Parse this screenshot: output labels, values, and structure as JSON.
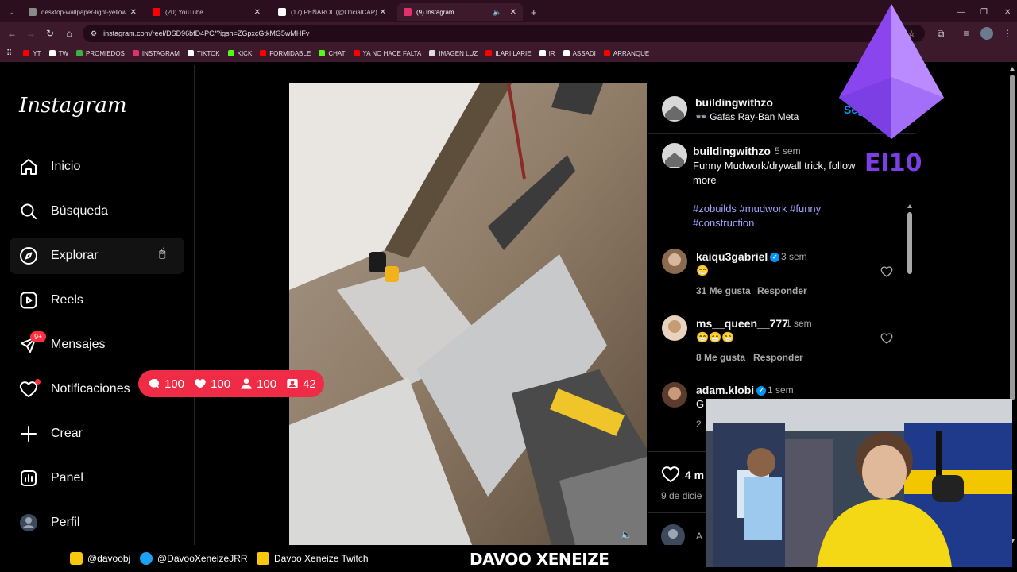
{
  "browser": {
    "tabs": [
      {
        "label": "desktop-wallpaper-light-yellow",
        "favicon_color": "#8a8a8a"
      },
      {
        "label": "(20) YouTube",
        "favicon_color": "#ff0000"
      },
      {
        "label": "(17) PEÑAROL (@OficialCAP) /",
        "favicon_color": "#ffffff"
      },
      {
        "label": "(9) Instagram",
        "favicon_color": "#e1306c"
      }
    ],
    "url": "instagram.com/reel/DSD96bfD4PC/?igsh=ZGpxcGtkMG5wMHFv",
    "bookmarks": [
      {
        "label": "YT",
        "color": "#ff0000"
      },
      {
        "label": "TW",
        "color": "#ffffff"
      },
      {
        "label": "PROMIEDOS",
        "color": "#3cb043"
      },
      {
        "label": "INSTAGRAM",
        "color": "#e1306c"
      },
      {
        "label": "TIKTOK",
        "color": "#ffffff"
      },
      {
        "label": "KICK",
        "color": "#53fc18"
      },
      {
        "label": "FORMIDABLE",
        "color": "#ff0000"
      },
      {
        "label": "CHAT",
        "color": "#53fc18"
      },
      {
        "label": "YA NO HACE FALTA",
        "color": "#ff0000"
      },
      {
        "label": "IMAGEN LUZ",
        "color": "#dddddd"
      },
      {
        "label": "ILARI LARIE",
        "color": "#ff0000"
      },
      {
        "label": "IR",
        "color": "#ffffff"
      },
      {
        "label": "ASSADI",
        "color": "#ffffff"
      },
      {
        "label": "ARRANQUE",
        "color": "#ff0000"
      }
    ]
  },
  "sidebar": {
    "logo": "Instagram",
    "items": [
      {
        "label": "Inicio",
        "icon": "home-icon"
      },
      {
        "label": "Búsqueda",
        "icon": "search-icon"
      },
      {
        "label": "Explorar",
        "icon": "compass-icon"
      },
      {
        "label": "Reels",
        "icon": "reels-icon"
      },
      {
        "label": "Mensajes",
        "icon": "messenger-icon"
      },
      {
        "label": "Notificaciones",
        "icon": "heart-icon"
      },
      {
        "label": "Crear",
        "icon": "plus-icon"
      },
      {
        "label": "Panel",
        "icon": "chart-icon"
      },
      {
        "label": "Perfil",
        "icon": "avatar"
      }
    ],
    "messages_badge": "9+"
  },
  "post": {
    "author": "buildingwithzo",
    "subtitle": "Gafas Ray-Ban Meta",
    "follow_label": "Seg",
    "caption_author": "buildingwithzo",
    "caption_time": "5 sem",
    "caption_text": "Funny Mudwork/drywall trick, follow",
    "caption_more": "more",
    "hashtags_line1": "#zobuilds #mudwork #funny",
    "hashtags_line2": "#construction",
    "likes_prefix": "4 m",
    "date_prefix": "9 de dicie",
    "comment_input_prefix": "A"
  },
  "comments": [
    {
      "user": "kaiqu3gabriel",
      "verified": true,
      "time": "3 sem",
      "text": "😁",
      "likes": "31 Me gusta",
      "reply": "Responder"
    },
    {
      "user": "ms__queen__777",
      "verified": false,
      "time": "1 sem",
      "text": "😁😁😁",
      "likes": "8 Me gusta",
      "reply": "Responder"
    },
    {
      "user": "adam.klobi",
      "verified": true,
      "time": "1 sem",
      "text": "G",
      "likes": "2",
      "reply": ""
    }
  ],
  "overlay": {
    "stats": [
      {
        "icon": "comment-icon",
        "value": "100"
      },
      {
        "icon": "heart-icon",
        "value": "100"
      },
      {
        "icon": "user-icon",
        "value": "100"
      },
      {
        "icon": "contact-icon",
        "value": "42"
      }
    ],
    "logo_text": "El10",
    "socials": [
      {
        "label": "@davoobj",
        "color": "#f9c80e"
      },
      {
        "label": "@DavooXeneizeJRR",
        "color": "#1da1f2"
      },
      {
        "label": "Davoo Xeneize Twitch",
        "color": "#f9c80e"
      }
    ],
    "streamer_name": "DAVOO XENEIZE",
    "accent_color": "#ef2b46"
  }
}
